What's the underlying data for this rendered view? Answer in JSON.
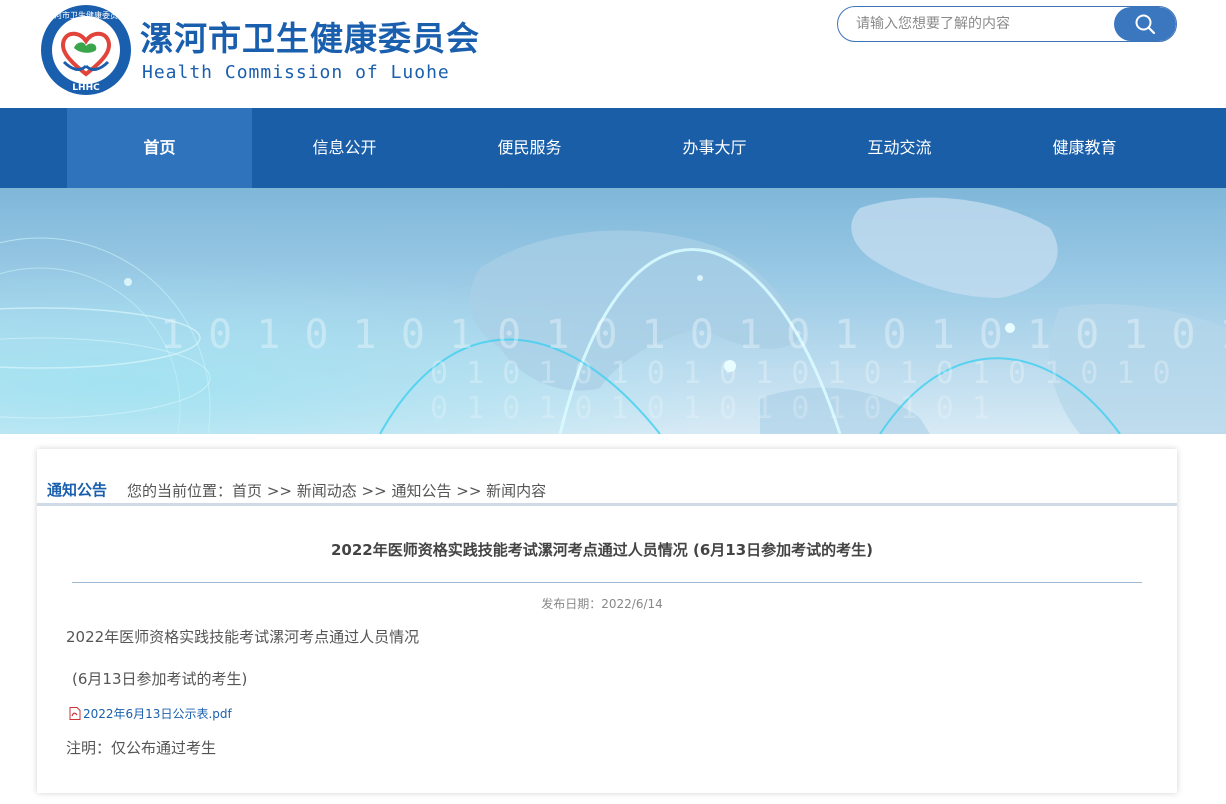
{
  "header": {
    "site_name": "漯河市卫生健康委员会",
    "site_name_en": "Health Commission of Luohe",
    "logo_text_top": "漯河市卫生健康委员会",
    "logo_text_bottom": "LHHC",
    "search_placeholder": "请输入您想要了解的内容",
    "search_icon": "search-icon"
  },
  "nav": {
    "items": [
      {
        "label": "首页",
        "active": true
      },
      {
        "label": "信息公开",
        "active": false
      },
      {
        "label": "便民服务",
        "active": false
      },
      {
        "label": "办事大厅",
        "active": false
      },
      {
        "label": "互动交流",
        "active": false
      },
      {
        "label": "健康教育",
        "active": false
      }
    ]
  },
  "breadcrumb": {
    "section_title": "通知公告",
    "prefix": "您的当前位置：",
    "items": [
      "首页",
      "新闻动态",
      "通知公告",
      "新闻内容"
    ],
    "separator": ">>"
  },
  "article": {
    "title": "2022年医师资格实践技能考试漯河考点通过人员情况   (6月13日参加考试的考生)",
    "date_label": "发布日期：",
    "date_value": "2022/6/14",
    "paragraph1": "2022年医师资格实践技能考试漯河考点通过人员情况",
    "paragraph2": "(6月13日参加考试的考生)",
    "attachment": "2022年6月13日公示表.pdf",
    "attachment_icon": "pdf-icon",
    "note": "注明：仅公布通过考生"
  },
  "colors": {
    "brand": "#1a5fae",
    "nav_bg": "#1a5ea8",
    "nav_active": "#2f73bd"
  }
}
